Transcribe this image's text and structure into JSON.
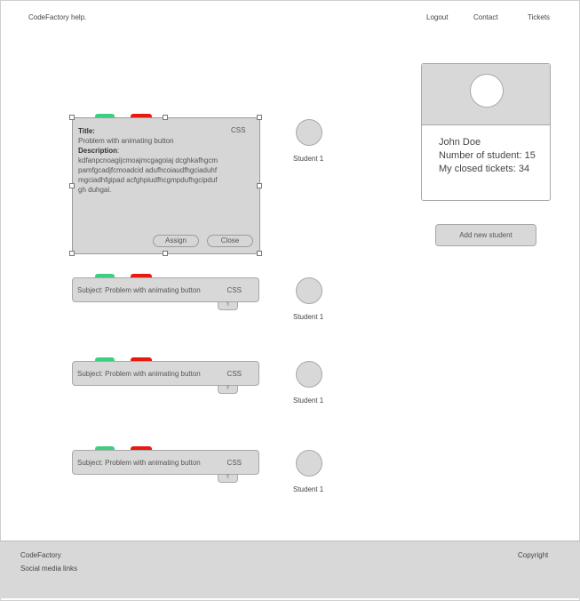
{
  "header": {
    "brand": "CodeFactory help.",
    "nav": {
      "logout": "Logout",
      "contact": "Contact",
      "tickets": "Tickets"
    }
  },
  "expanded_ticket": {
    "title_label": "Title:",
    "title": "Problem with animating button",
    "description_label": "Description",
    "description_colon": ":",
    "description": "kdfanpcnoagijcmoajmcgagoiaj dcghkafhgcmpamfgcadjfcmoadcid adufhcoiaudfhgciaduhfmgciadhfgipad acfghpiudfhcgmpdufhgcipdufgh duhgai.",
    "tag": "CSS",
    "assign_label": "Assign",
    "close_label": "Close"
  },
  "tickets": [
    {
      "subject": "Subject: Problem with animating button",
      "tag": "CSS",
      "toggle": "⇑"
    },
    {
      "subject": "Subject: Problem with animating button",
      "tag": "CSS",
      "toggle": "⇑"
    },
    {
      "subject": "Subject: Problem with animating button",
      "tag": "CSS",
      "toggle": "⇑"
    }
  ],
  "students": [
    {
      "label": "Student 1"
    },
    {
      "label": "Student 1"
    },
    {
      "label": "Student 1"
    },
    {
      "label": "Student 1"
    }
  ],
  "profile": {
    "name": "John Doe",
    "students_count": "Number of student: 15",
    "closed_tickets": "My closed tickets: 34"
  },
  "add_student_label": "Add new student",
  "footer": {
    "company": "CodeFactory",
    "social": "Social media links",
    "copyright": "Copyright"
  },
  "colors": {
    "status_green": "#3ad07f",
    "status_red": "#e8190d",
    "panel_gray": "#d8d8d8"
  }
}
